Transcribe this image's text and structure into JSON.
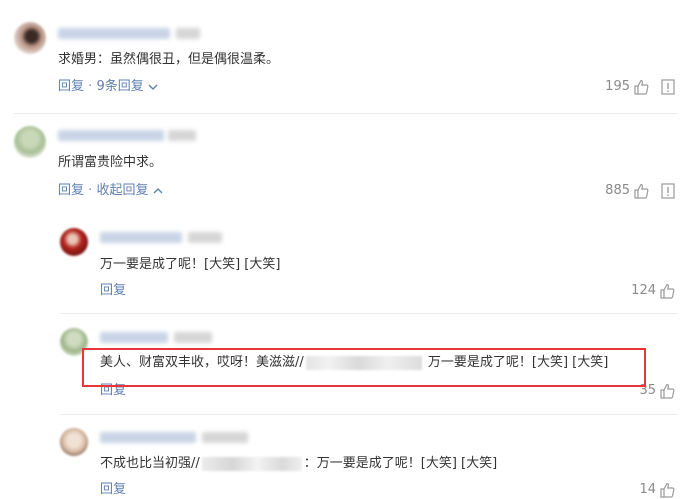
{
  "comments": [
    {
      "text": "求婚男：虽然偶很丑，但是偶很温柔。",
      "reply_label": "回复",
      "separator": "·",
      "expand_label": "9条回复",
      "likes": "195"
    },
    {
      "text": "所谓富贵险中求。",
      "reply_label": "回复",
      "separator": "·",
      "collapse_label": "收起回复",
      "likes": "885",
      "replies": [
        {
          "text": "万一要是成了呢！[大笑] [大笑]",
          "reply_label": "回复",
          "likes": "124"
        },
        {
          "text_prefix": "美人、财富双丰收，哎呀！美滋滋//",
          "text_suffix": "万一要是成了呢！[大笑] [大笑]",
          "reply_label": "回复",
          "likes": "35"
        },
        {
          "text_prefix": "不成也比当初强//",
          "text_suffix": "：万一要是成了呢！[大笑] [大笑]",
          "reply_label": "回复",
          "likes": "14"
        }
      ]
    }
  ],
  "icons": {
    "like": "thumbs-up-icon",
    "report": "report-icon",
    "chevron_down": "chevron-down-icon",
    "chevron_up": "chevron-up-icon"
  },
  "colors": {
    "link": "#5f7fb0",
    "highlight": "#e8353b",
    "text": "#333333",
    "muted": "#8a8a8a"
  }
}
